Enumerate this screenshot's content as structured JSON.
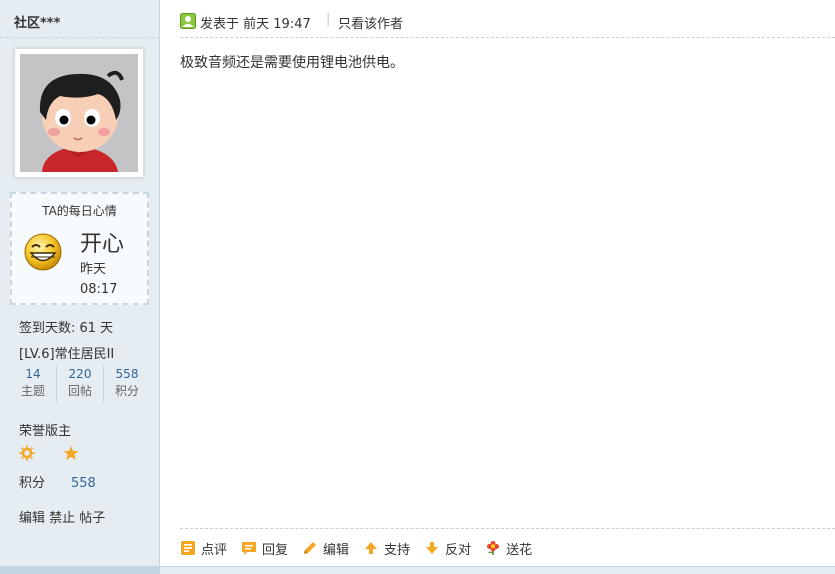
{
  "user": {
    "name": "社区***"
  },
  "mood": {
    "title": "TA的每日心情",
    "word": "开心",
    "time": "昨天 08:17"
  },
  "stats": {
    "sign_days": "签到天数: 61 天",
    "level": "[LV.6]常住居民II",
    "counters": [
      {
        "num": "14",
        "label": "主题"
      },
      {
        "num": "220",
        "label": "回帖"
      },
      {
        "num": "558",
        "label": "积分"
      }
    ],
    "group": "荣誉版主",
    "score_label": "积分",
    "score_value": "558",
    "admin_links": "编辑 禁止 帖子"
  },
  "post": {
    "posted_label": "发表于",
    "posted_time": "前天 19:47",
    "divider": "|",
    "only_author": "只看该作者",
    "content": "极致音频还是需要使用锂电池供电。"
  },
  "actions": [
    {
      "label": "点评",
      "icon": "comment-icon"
    },
    {
      "label": "回复",
      "icon": "reply-icon"
    },
    {
      "label": "编辑",
      "icon": "edit-icon"
    },
    {
      "label": "支持",
      "icon": "thumb-up-icon"
    },
    {
      "label": "反对",
      "icon": "thumb-down-icon"
    },
    {
      "label": "送花",
      "icon": "flower-icon"
    }
  ],
  "colors": {
    "side_bg": "#e5edf2",
    "border": "#c2d5e3",
    "link": "#336699",
    "accent_orange": "#f5a623"
  }
}
